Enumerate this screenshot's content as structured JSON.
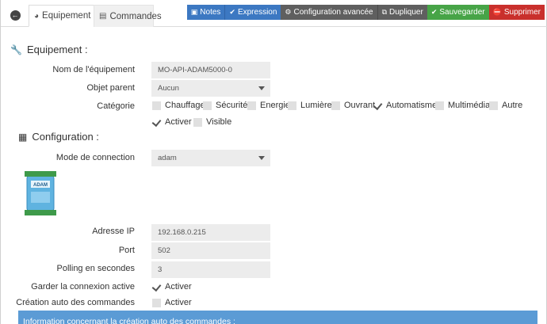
{
  "tabs": {
    "back_icon": "arrow-left-icon",
    "equipement": "Equipement",
    "commandes": "Commandes"
  },
  "toolbar": {
    "notes": "Notes",
    "expression": "Expression",
    "configuration_avancee": "Configuration avancée",
    "dupliquer": "Dupliquer",
    "sauvegarder": "Sauvegarder",
    "supprimer": "Supprimer"
  },
  "colors": {
    "primary": "#3c78c2",
    "neutral": "#5f5f5f",
    "success": "#47a447",
    "danger": "#c9302c",
    "info": "#5b9bd5"
  },
  "equipement_section": {
    "title": "Equipement :",
    "nom_label": "Nom de l'équipement",
    "nom_value": "MO-API-ADAM5000-0",
    "objet_label": "Objet parent",
    "objet_value": "Aucun",
    "categorie_label": "Catégorie",
    "categories": [
      {
        "label": "Chauffage",
        "checked": false
      },
      {
        "label": "Sécurité",
        "checked": false
      },
      {
        "label": "Energie",
        "checked": false
      },
      {
        "label": "Lumière",
        "checked": false
      },
      {
        "label": "Ouvrant",
        "checked": false
      },
      {
        "label": "Automatisme",
        "checked": true
      },
      {
        "label": "Multimédia",
        "checked": false
      },
      {
        "label": "Autre",
        "checked": false
      }
    ],
    "activer_label": "Activer",
    "activer_checked": true,
    "visible_label": "Visible",
    "visible_checked": false
  },
  "configuration_section": {
    "title": "Configuration :",
    "mode_label": "Mode de connection",
    "mode_value": "adam",
    "device_logo_text": "ADAM",
    "ip_label": "Adresse IP",
    "ip_value": "192.168.0.215",
    "port_label": "Port",
    "port_value": "502",
    "polling_label": "Polling en secondes",
    "polling_value": "3",
    "garder_label": "Garder la connexion active",
    "garder_option": "Activer",
    "garder_checked": true,
    "creation_label": "Création auto des commandes",
    "creation_option": "Activer",
    "creation_checked": false
  },
  "info_banner": "Information concernant la création auto des commandes :"
}
